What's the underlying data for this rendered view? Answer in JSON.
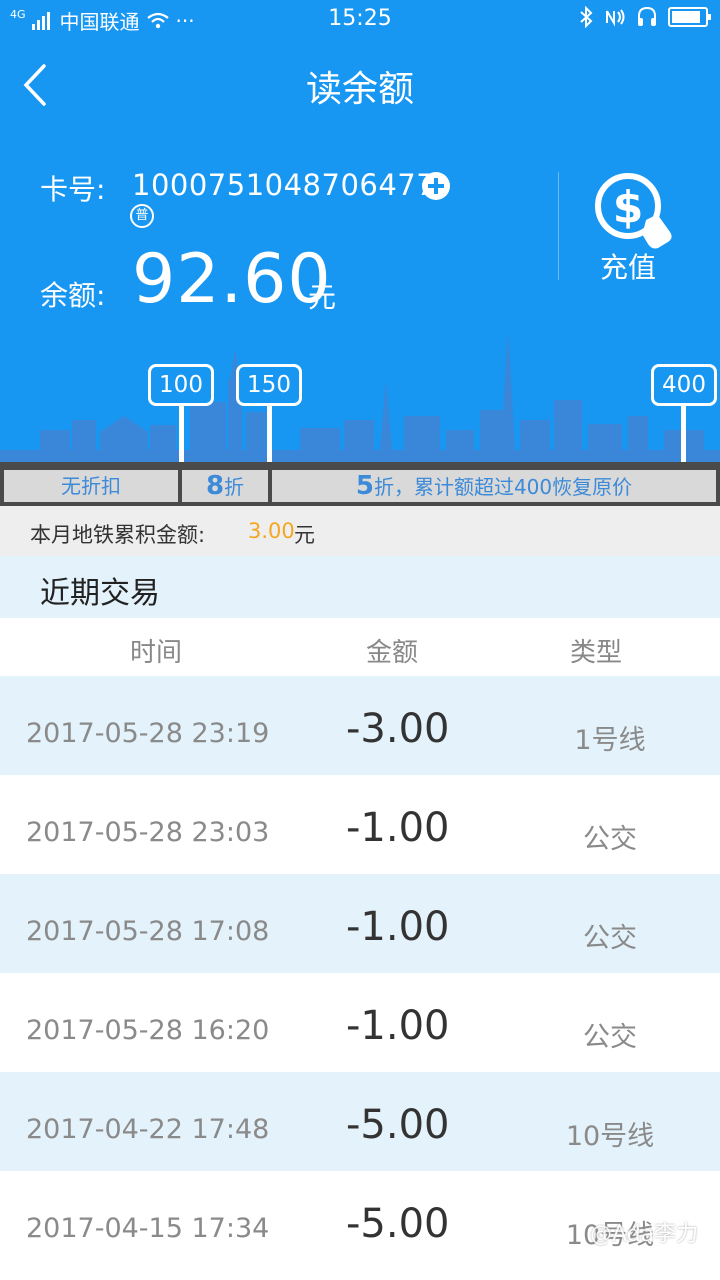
{
  "status_bar": {
    "network": "4G",
    "carrier": "中国联通",
    "dots": "···",
    "time": "15:25"
  },
  "header": {
    "title": "读余额"
  },
  "card": {
    "number_label": "卡号:",
    "number": "1000751048706477",
    "badge": "普",
    "balance_label": "余额:",
    "balance": "92.60",
    "balance_unit": "元",
    "recharge_label": "充值"
  },
  "thresholds": [
    "100",
    "150",
    "400"
  ],
  "discount": {
    "no_discount": "无折扣",
    "tier2_big": "8",
    "tier2_small": "折",
    "tier3_big": "5",
    "tier3_small": "折，累计额超过400恢复原价"
  },
  "monthly": {
    "label": "本月地铁累积金额:",
    "amount": "3.00",
    "unit": "元"
  },
  "recent_title": "近期交易",
  "table": {
    "headers": {
      "time": "时间",
      "amount": "金额",
      "type": "类型"
    },
    "rows": [
      {
        "time": "2017-05-28  23:19",
        "amount": "-3.00",
        "type": "1号线"
      },
      {
        "time": "2017-05-28  23:03",
        "amount": "-1.00",
        "type": "公交"
      },
      {
        "time": "2017-05-28  17:08",
        "amount": "-1.00",
        "type": "公交"
      },
      {
        "time": "2017-05-28  16:20",
        "amount": "-1.00",
        "type": "公交"
      },
      {
        "time": "2017-04-22  17:48",
        "amount": "-5.00",
        "type": "10号线"
      },
      {
        "time": "2017-04-15  17:34",
        "amount": "-5.00",
        "type": "10号线"
      }
    ]
  },
  "watermark": "@Ada李力",
  "colors": {
    "primary": "#1897f2",
    "accent_amount": "#f5a623",
    "row_alt": "#e4f2fb"
  }
}
